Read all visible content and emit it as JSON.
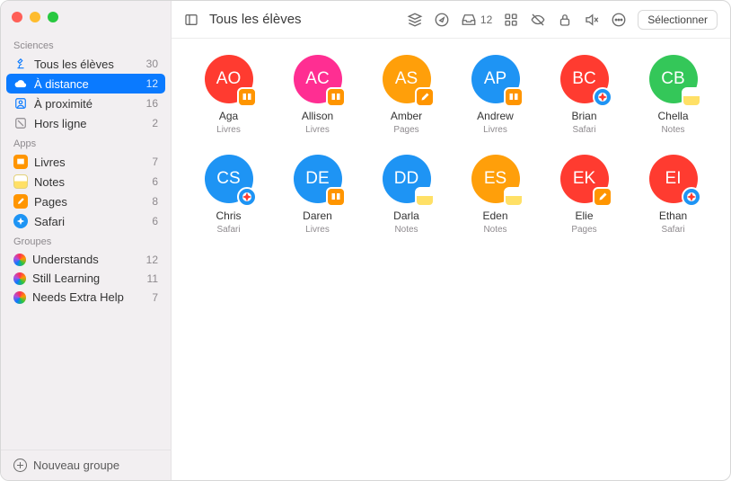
{
  "header": {
    "title": "Tous les élèves",
    "inbox_count": 12,
    "select_label": "Sélectionner"
  },
  "sidebar": {
    "sections": [
      {
        "title": "Sciences",
        "items": [
          {
            "icon": "microscope",
            "label": "Tous les élèves",
            "count": 30
          },
          {
            "icon": "cloud",
            "label": "À distance",
            "count": 12,
            "selected": true
          },
          {
            "icon": "person-square",
            "label": "À proximité",
            "count": 16
          },
          {
            "icon": "offline",
            "label": "Hors ligne",
            "count": 2
          }
        ]
      },
      {
        "title": "Apps",
        "items": [
          {
            "icon": "app-livres",
            "label": "Livres",
            "count": 7
          },
          {
            "icon": "app-notes",
            "label": "Notes",
            "count": 6
          },
          {
            "icon": "app-pages",
            "label": "Pages",
            "count": 8
          },
          {
            "icon": "app-safari",
            "label": "Safari",
            "count": 6
          }
        ]
      },
      {
        "title": "Groupes",
        "items": [
          {
            "icon": "group",
            "label": "Understands",
            "count": 12
          },
          {
            "icon": "group",
            "label": "Still Learning",
            "count": 11
          },
          {
            "icon": "group",
            "label": "Needs Extra Help",
            "count": 7
          }
        ]
      }
    ],
    "footer": {
      "label": "Nouveau groupe"
    }
  },
  "students": [
    {
      "initials": "AO",
      "name": "Aga",
      "app": "Livres",
      "color": "#ff3b30",
      "badge": "livres"
    },
    {
      "initials": "AC",
      "name": "Allison",
      "app": "Livres",
      "color": "#ff2e92",
      "badge": "livres"
    },
    {
      "initials": "AS",
      "name": "Amber",
      "app": "Pages",
      "color": "#ff9f0a",
      "badge": "pages"
    },
    {
      "initials": "AP",
      "name": "Andrew",
      "app": "Livres",
      "color": "#1e94f4",
      "badge": "livres"
    },
    {
      "initials": "BC",
      "name": "Brian",
      "app": "Safari",
      "color": "#ff3b30",
      "badge": "safari"
    },
    {
      "initials": "CB",
      "name": "Chella",
      "app": "Notes",
      "color": "#34c759",
      "badge": "notes"
    },
    {
      "initials": "CS",
      "name": "Chris",
      "app": "Safari",
      "color": "#1e94f4",
      "badge": "safari"
    },
    {
      "initials": "DE",
      "name": "Daren",
      "app": "Livres",
      "color": "#1e94f4",
      "badge": "livres"
    },
    {
      "initials": "DD",
      "name": "Darla",
      "app": "Notes",
      "color": "#1e94f4",
      "badge": "notes"
    },
    {
      "initials": "ES",
      "name": "Eden",
      "app": "Notes",
      "color": "#ff9f0a",
      "badge": "notes"
    },
    {
      "initials": "EK",
      "name": "Elie",
      "app": "Pages",
      "color": "#ff3b30",
      "badge": "pages"
    },
    {
      "initials": "EI",
      "name": "Ethan",
      "app": "Safari",
      "color": "#ff3b30",
      "badge": "safari"
    }
  ]
}
